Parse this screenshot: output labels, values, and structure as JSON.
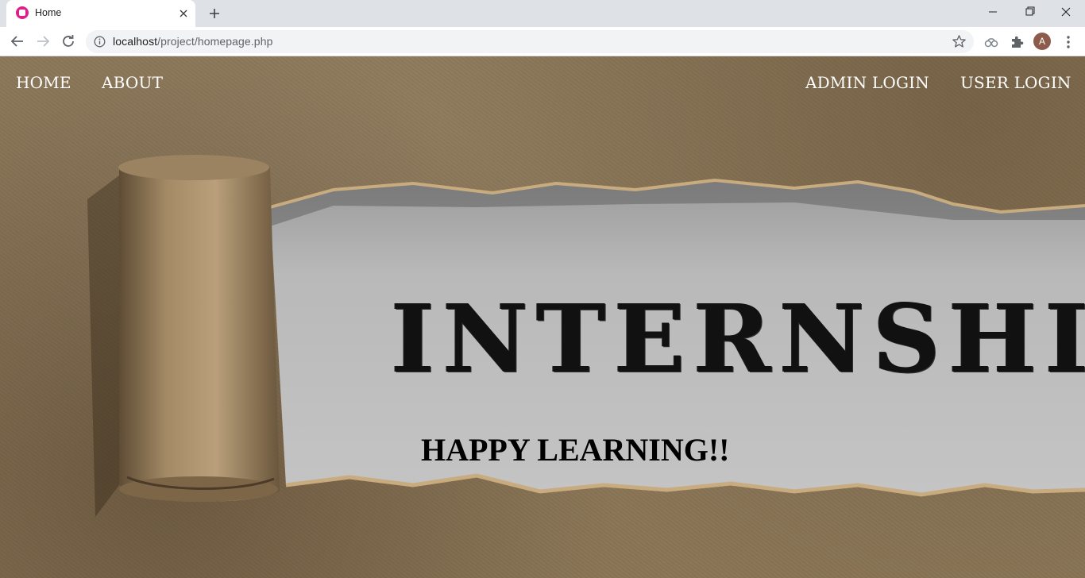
{
  "browser": {
    "tab_title": "Home",
    "url_host": "localhost",
    "url_path": "/project/homepage.php",
    "avatar_initial": "A"
  },
  "icons": {
    "favicon": "wamp-icon",
    "tab_close": "close-icon",
    "new_tab": "plus-icon",
    "back": "arrow-left-icon",
    "forward": "arrow-right-icon",
    "reload": "reload-icon",
    "site_info": "info-icon",
    "bookmark": "star-icon",
    "sync": "sync-icon",
    "extensions": "puzzle-icon",
    "menu": "more-vertical-icon"
  },
  "nav": {
    "home": "HOME",
    "about": "ABOUT",
    "admin_login": "ADMIN LOGIN",
    "user_login": "USER LOGIN"
  },
  "hero": {
    "word": "INTERNSHIP",
    "tagline": "HAPPY LEARNING!!"
  },
  "colors": {
    "cardboard": "#8a7556",
    "paper_gap": "#b7b7b7",
    "nav_text": "#ffffff",
    "favicon_accent": "#e01e8a"
  }
}
